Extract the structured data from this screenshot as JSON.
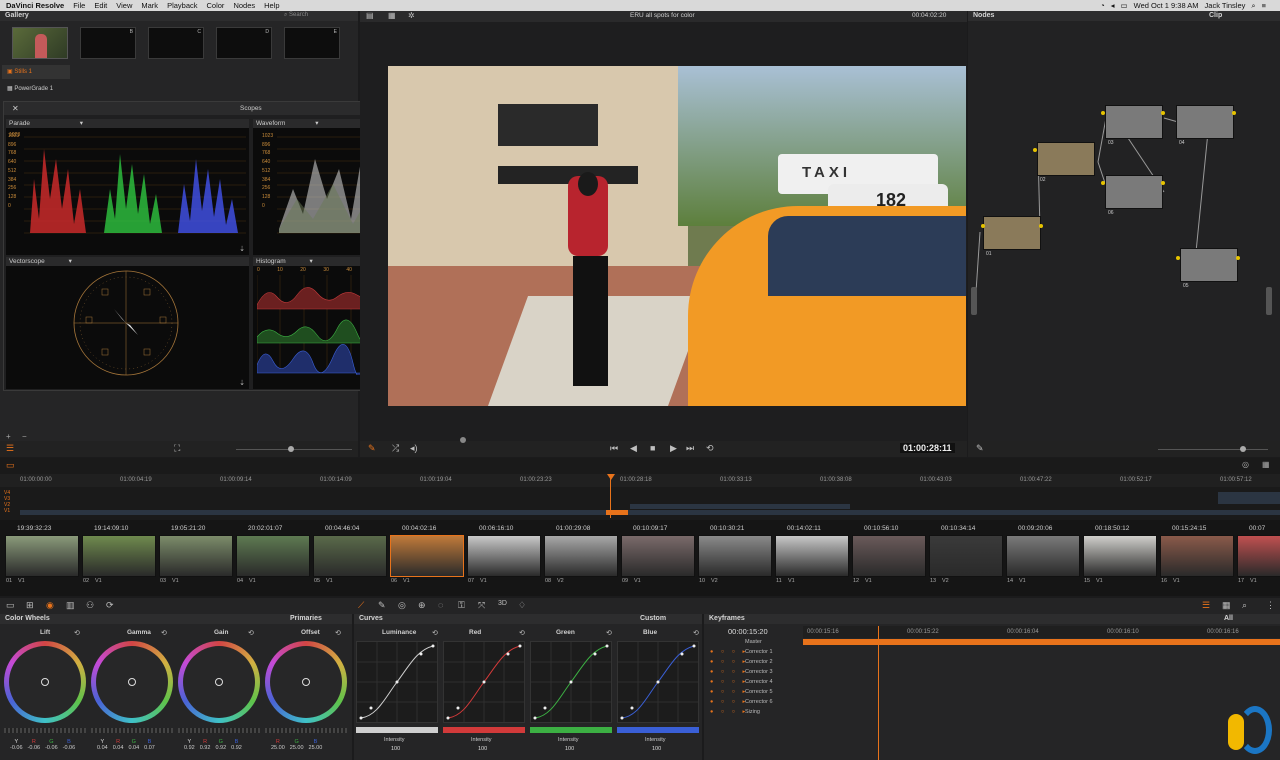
{
  "menubar": {
    "app": "DaVinci Resolve",
    "items": [
      "File",
      "Edit",
      "View",
      "Mark",
      "Playback",
      "Color",
      "Nodes",
      "Help"
    ],
    "datetime": "Wed Oct 1  9:38 AM",
    "user": "Jack Tinsley"
  },
  "gallery": {
    "title": "Gallery",
    "search_placeholder": "Search",
    "albums": [
      "Stills 1",
      "PowerGrade 1"
    ],
    "slot_letters": [
      "A",
      "B",
      "C",
      "D",
      "E"
    ]
  },
  "viewer": {
    "clip_title": "ERU all spots for color",
    "timecode_top": "00:04:02:20",
    "timecode": "01:00:28:11",
    "taxi_number": "182",
    "taxi_sign": "TAXI"
  },
  "scopes": {
    "title": "Scopes",
    "aspect": "16x9",
    "layout_options": [
      "1",
      "2",
      "4"
    ],
    "parade_label": "Parade",
    "waveform_label": "Waveform",
    "vectorscope_label": "Vectorscope",
    "histogram_label": "Histogram",
    "scale": [
      "1023",
      "896",
      "768",
      "640",
      "512",
      "384",
      "256",
      "128",
      "0"
    ],
    "hist_scale": [
      "0",
      "10",
      "20",
      "30",
      "40",
      "50",
      "60",
      "70",
      "80",
      "90",
      "100"
    ]
  },
  "nodes": {
    "title": "Nodes",
    "mode": "Clip",
    "labels": [
      "01",
      "02",
      "03",
      "04",
      "05",
      "06"
    ]
  },
  "timeline": {
    "ruler": [
      "01:00:00:00",
      "01:00:04:19",
      "01:00:09:14",
      "01:00:14:09",
      "01:00:19:04",
      "01:00:23:23",
      "01:00:28:18",
      "01:00:33:13",
      "01:00:38:08",
      "01:00:43:03",
      "01:00:47:22",
      "01:00:52:17",
      "01:00:57:12"
    ],
    "tracks": [
      "V4",
      "V3",
      "V2",
      "V1"
    ],
    "clips": [
      {
        "tc": "19:39:32:23",
        "num": "01",
        "track": "V1"
      },
      {
        "tc": "19:14:09:10",
        "num": "02",
        "track": "V1"
      },
      {
        "tc": "19:05:21:20",
        "num": "03",
        "track": "V1"
      },
      {
        "tc": "20:02:01:07",
        "num": "04",
        "track": "V1"
      },
      {
        "tc": "00:04:46:04",
        "num": "05",
        "track": "V1"
      },
      {
        "tc": "00:04:02:16",
        "num": "06",
        "track": "V1"
      },
      {
        "tc": "00:06:16:10",
        "num": "07",
        "track": "V1"
      },
      {
        "tc": "01:00:29:08",
        "num": "08",
        "track": "V2"
      },
      {
        "tc": "00:10:09:17",
        "num": "09",
        "track": "V1"
      },
      {
        "tc": "00:10:30:21",
        "num": "10",
        "track": "V2"
      },
      {
        "tc": "00:14:02:11",
        "num": "11",
        "track": "V1"
      },
      {
        "tc": "00:10:56:10",
        "num": "12",
        "track": "V1"
      },
      {
        "tc": "00:10:34:14",
        "num": "13",
        "track": "V2"
      },
      {
        "tc": "00:09:20:06",
        "num": "14",
        "track": "V1"
      },
      {
        "tc": "00:18:50:12",
        "num": "15",
        "track": "V1"
      },
      {
        "tc": "00:15:24:15",
        "num": "16",
        "track": "V1"
      },
      {
        "tc": "00:07",
        "num": "17",
        "track": "V1"
      }
    ]
  },
  "color_wheels": {
    "title": "Color Wheels",
    "mode": "Primaries",
    "wheels": [
      {
        "label": "Lift",
        "channels": [
          "Y",
          "R",
          "G",
          "B"
        ],
        "values": [
          "-0.06",
          "-0.06",
          "-0.06",
          "-0.06"
        ]
      },
      {
        "label": "Gamma",
        "channels": [
          "Y",
          "R",
          "G",
          "B"
        ],
        "values": [
          "0.04",
          "0.04",
          "0.04",
          "0.07"
        ]
      },
      {
        "label": "Gain",
        "channels": [
          "Y",
          "R",
          "G",
          "B"
        ],
        "values": [
          "0.92",
          "0.92",
          "0.92",
          "0.92"
        ]
      },
      {
        "label": "Offset",
        "channels": [
          "R",
          "G",
          "B"
        ],
        "values": [
          "25.00",
          "25.00",
          "25.00"
        ]
      }
    ]
  },
  "curves": {
    "title": "Curves",
    "mode": "Custom",
    "channels": [
      {
        "label": "Luminance",
        "intensity_label": "Intensity",
        "value": "100",
        "color": "#cfcfcf"
      },
      {
        "label": "Red",
        "intensity_label": "Intensity",
        "value": "100",
        "color": "#d23a3a"
      },
      {
        "label": "Green",
        "intensity_label": "Intensity",
        "value": "100",
        "color": "#3cb043"
      },
      {
        "label": "Blue",
        "intensity_label": "Intensity",
        "value": "100",
        "color": "#3a5fd6"
      }
    ]
  },
  "keyframes": {
    "title": "Keyframes",
    "filter": "All",
    "timecode": "00:00:15:20",
    "ruler": [
      "00:00:15:16",
      "00:00:15:22",
      "00:00:16:04",
      "00:00:16:10",
      "00:00:16:16"
    ],
    "rows": [
      "Master",
      "Corrector 1",
      "Corrector 2",
      "Corrector 3",
      "Corrector 4",
      "Corrector 5",
      "Corrector 6",
      "Sizing"
    ]
  },
  "colors": {
    "accent": "#e8731b",
    "panel": "#252526",
    "background": "#1b1b1c"
  }
}
